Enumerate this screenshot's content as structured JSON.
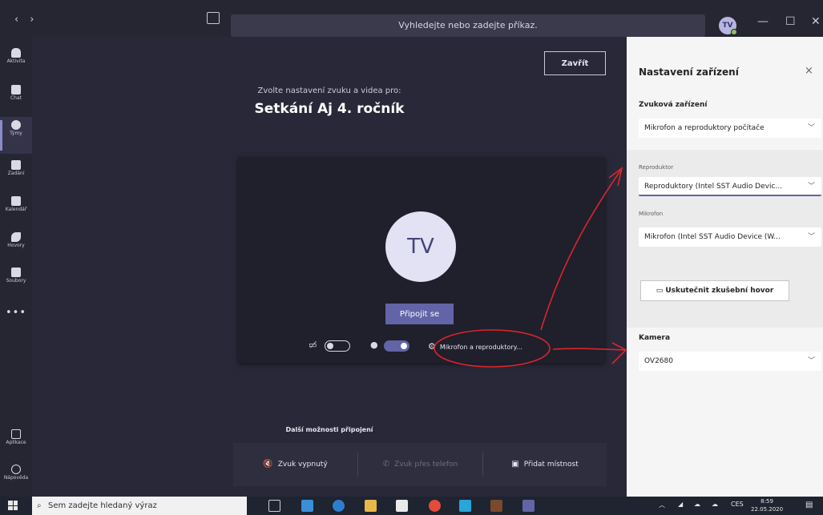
{
  "titlebar": {
    "nav_back": "‹",
    "nav_forward": "›",
    "search_text": "Vyhledejte nebo zadejte příkaz.",
    "avatar": "TV",
    "minimize": "—",
    "maximize": "☐",
    "close": "✕"
  },
  "rail": {
    "items": [
      {
        "label": "Aktivita",
        "icon": "bell-icon"
      },
      {
        "label": "Chat",
        "icon": "chat-icon"
      },
      {
        "label": "Týmy",
        "icon": "teams-icon"
      },
      {
        "label": "Zadání",
        "icon": "assignments-icon"
      },
      {
        "label": "Kalendář",
        "icon": "calendar-icon"
      },
      {
        "label": "Hovory",
        "icon": "phone-icon"
      },
      {
        "label": "Soubory",
        "icon": "files-icon"
      }
    ],
    "more": "•••",
    "apps_label": "Aplikace",
    "help_label": "Nápověda"
  },
  "stage": {
    "close_label": "Zavřít",
    "subtitle": "Zvolte nastavení zvuku a videa pro:",
    "meeting_title": "Setkání Aj 4. ročník",
    "avatar": "TV",
    "join_label": "Připojit se",
    "video_on": false,
    "mic_on": true,
    "device_link": "Mikrofon a reproduktory...",
    "more_options": "Další možnosti připojení",
    "options": [
      {
        "label": "Zvuk vypnutý",
        "icon": "speaker-off-icon",
        "disabled": false
      },
      {
        "label": "Zvuk přes telefon",
        "icon": "phone-icon",
        "disabled": true
      },
      {
        "label": "Přidat místnost",
        "icon": "cast-icon",
        "disabled": false
      }
    ]
  },
  "panel": {
    "title": "Nastavení zařízení",
    "close": "×",
    "audio_label": "Zvuková zařízení",
    "audio_value": "Mikrofon a reproduktory počítače",
    "speaker_label": "Reproduktor",
    "speaker_value": "Reproduktory (Intel SST Audio Devic...",
    "mic_label": "Mikrofon",
    "mic_value": "Mikrofon (Intel SST Audio Device (W...",
    "test_call": "Uskutečnit zkušební hovor",
    "camera_label": "Kamera",
    "camera_value": "OV2680"
  },
  "taskbar": {
    "search_placeholder": "Sem zadejte hledaný výraz",
    "lang": "CES",
    "time": "8:59",
    "date": "22.05.2020"
  },
  "colors": {
    "accent": "#6264a7",
    "annotation": "#d9262b"
  }
}
